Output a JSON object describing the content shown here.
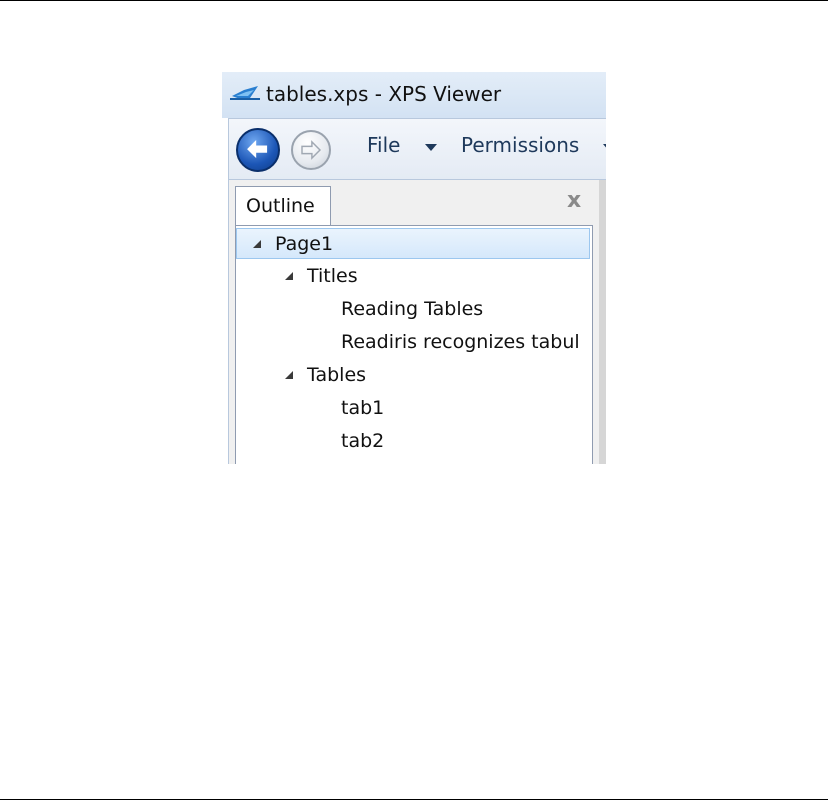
{
  "window": {
    "title": "tables.xps - XPS Viewer"
  },
  "toolbar": {
    "back_icon": "back-arrow-icon",
    "forward_icon": "forward-arrow-icon",
    "file_menu": "File",
    "permissions_menu": "Permissions"
  },
  "panel": {
    "tab_label": "Outline",
    "close_label": "x"
  },
  "outline": {
    "items": [
      {
        "label": "Page1",
        "level": 0,
        "expanded": true,
        "selected": true
      },
      {
        "label": "Titles",
        "level": 1,
        "expanded": true
      },
      {
        "label": "Reading Tables",
        "level": 2
      },
      {
        "label": "Readiris recognizes tabul",
        "level": 2
      },
      {
        "label": "Tables",
        "level": 1,
        "expanded": true
      },
      {
        "label": "tab1",
        "level": 2
      },
      {
        "label": "tab2",
        "level": 2
      }
    ]
  },
  "colors": {
    "accent": "#1c56b6",
    "menu_text": "#1e395b",
    "selection": "#d5e8fb"
  }
}
